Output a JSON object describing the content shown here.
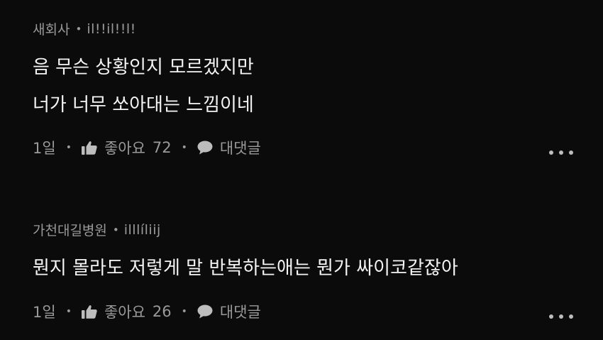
{
  "comments": [
    {
      "author": "새회사",
      "level": "il!!il!!l!",
      "lines": [
        "음 무슨 상황인지 모르겠지만",
        "너가 너무 쏘아대는 느낌이네"
      ],
      "time": "1일",
      "like_label": "좋아요",
      "like_count": "72",
      "reply_label": "대댓글"
    },
    {
      "author": "가천대길병원",
      "level": "illlíliij",
      "lines": [
        "뭔지 몰라도 저렇게 말 반복하는애는 뭔가 싸이코같잖아"
      ],
      "time": "1일",
      "like_label": "좋아요",
      "like_count": "26",
      "reply_label": "대댓글"
    }
  ],
  "icons": {
    "like": "thumbs-up-icon",
    "reply": "speech-bubble-icon",
    "more": "more-dots-icon"
  },
  "colors": {
    "background": "#0b0b0b",
    "text": "#f4f4f4",
    "muted": "#9a9a9a"
  }
}
